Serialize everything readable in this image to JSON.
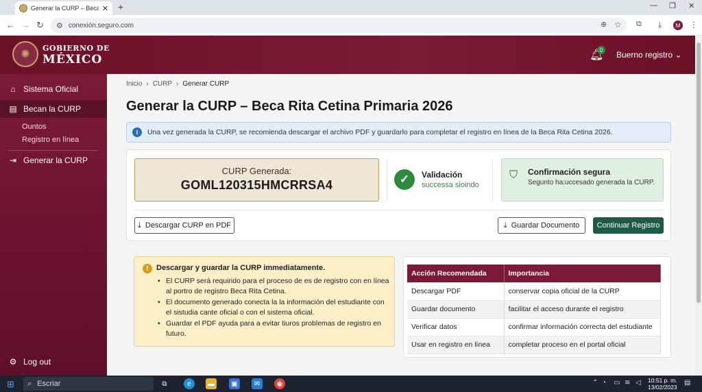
{
  "browser": {
    "tab_title": "Generar la CURP – Beca Rita C",
    "url": "conexión.seguro.com"
  },
  "header": {
    "logo_line1": "GOBIERNO DE",
    "logo_line2": "MÉXICO",
    "notifications_count": "0",
    "user_name": "Buerno registro"
  },
  "sidebar": {
    "items": [
      {
        "label": "Sistema Oficial"
      },
      {
        "label": "Becan la CURP"
      },
      {
        "label": "Generar la CURP"
      }
    ],
    "subitems": [
      {
        "label": "Ountos"
      },
      {
        "label": "Registro en línea"
      }
    ],
    "logout_label": "Log out"
  },
  "breadcrumb": [
    "Inicio",
    "CURP",
    "Generar CURP"
  ],
  "page_title": "Generar la CURP – Beca Rita Cetina Primaria 2026",
  "info_banner": "Una vez generada la CURP, se recomienda descargar el archivo PDF y guardarlo para completar el registro en línea de la Beca Rita Cetina 2026.",
  "curp": {
    "label": "CURP Generada:",
    "value": "GOML120315HMCRRSA4"
  },
  "validation": {
    "title": "Validación",
    "subtitle": "successa sioindo"
  },
  "secure": {
    "title": "Confirmación segura",
    "subtitle": "Segunto ha:uccesado generada la CURP."
  },
  "buttons": {
    "download_pdf": "Descargar CURP en PDF",
    "save_document": "Guardar Documento",
    "continue": "Continuar Registro"
  },
  "warning": {
    "title": "Descargar y guardar la CURP immediatamente.",
    "bullets": [
      "El CURP será requirido para el proceso de es de registro con en línea al portro de registro Beca Rita Cetina.",
      "El documento generado conecta la la información del estudiante con el sistudia cante oficial o con el sistema oficial.",
      "Guardar el PDF ayuda para a evitar tiuros problemas de registro en futuro."
    ]
  },
  "table": {
    "headers": [
      "Acción Recomendada",
      "Importancia"
    ],
    "rows": [
      [
        "Descargar PDF",
        "conservar copia oficial de la CURP"
      ],
      [
        "Guardar documento",
        "facilitar el acceso durante el registro"
      ],
      [
        "Verificar datos",
        "confirmar información correcta del estudiante"
      ],
      [
        "Usar en registro en línea",
        "completar proceso en el portal oficial"
      ]
    ]
  },
  "taskbar": {
    "search_label": "Escriar",
    "time": "10:51 p. m.",
    "date": "13/02/2023"
  },
  "colors": {
    "brand": "#7a1a35",
    "primary_button": "#1d5a48",
    "success": "#2d8a3e",
    "warning_bg": "#fbefc7"
  }
}
